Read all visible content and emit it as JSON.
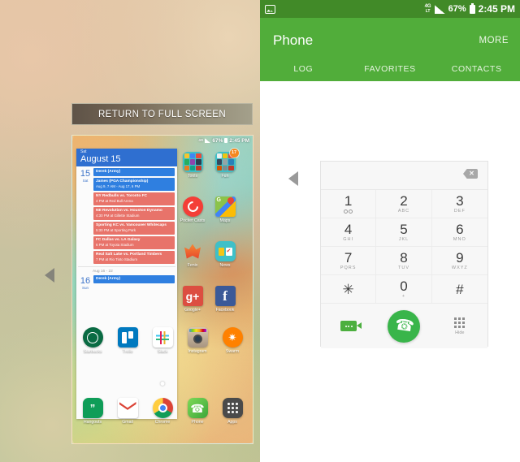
{
  "left": {
    "return_button": "RETURN TO FULL SCREEN",
    "drag_handle_icon": "left-triangle-icon",
    "preview": {
      "status": {
        "network": "4G",
        "network_sub": "LT",
        "battery": "67%",
        "time": "2:45 PM"
      },
      "calendar": {
        "header_dow": "Sat",
        "header_date": "August 15",
        "day_number": "15",
        "day_name": "Sat",
        "events": [
          {
            "title": "Derek (Army)",
            "sub": "",
            "color": "blue"
          },
          {
            "title": "James (PGA Championship)",
            "sub": "Aug 9, 7 AM - Aug 17, 6 PM",
            "color": "blue"
          },
          {
            "title": "NY Redbulls vs. Toronto FC",
            "sub": "4 PM at Red Bull Arena",
            "color": "red"
          },
          {
            "title": "NE Revolution vs. Houston Dynamo",
            "sub": "4:30 PM at Gillette Stadium",
            "color": "red"
          },
          {
            "title": "Sporting KC vs. Vancouver Whitecaps",
            "sub": "5:30 PM at Sporting Park",
            "color": "red"
          },
          {
            "title": "FC Dallas vs. LA Galaxy",
            "sub": "6 PM at Toyota Stadium",
            "color": "red"
          },
          {
            "title": "Real Salt Lake vs. Portland Timbers",
            "sub": "7 PM at Rio Tinto Stadium",
            "color": "red"
          }
        ],
        "week_separator": "Aug 16 - 22",
        "next_day_number": "16",
        "next_day_name": "Sun",
        "next_event": "Derek (Army)"
      },
      "apps_right": [
        {
          "label": "Tools",
          "badge": ""
        },
        {
          "label": "Fun",
          "badge": "17"
        },
        {
          "label": "Pocket Casts",
          "badge": ""
        },
        {
          "label": "Maps",
          "badge": ""
        },
        {
          "label": "Fenix",
          "badge": ""
        },
        {
          "label": "News",
          "badge": ""
        },
        {
          "label": "Google+",
          "badge": ""
        },
        {
          "label": "Facebook",
          "badge": ""
        }
      ],
      "apps_row": [
        {
          "label": "Starbucks"
        },
        {
          "label": "Trello"
        },
        {
          "label": "Slack"
        },
        {
          "label": "Instagram"
        },
        {
          "label": "Swarm"
        }
      ],
      "dock": [
        {
          "label": "Hangouts"
        },
        {
          "label": "Gmail"
        },
        {
          "label": "Chrome"
        },
        {
          "label": "Phone"
        },
        {
          "label": "Apps"
        }
      ]
    }
  },
  "right": {
    "status": {
      "screenshot_icon": "image-icon",
      "network": "4G",
      "network_sub": "LT",
      "battery": "67%",
      "time": "2:45 PM"
    },
    "appbar": {
      "title": "Phone",
      "more": "MORE",
      "tabs": [
        {
          "label": "LOG"
        },
        {
          "label": "FAVORITES"
        },
        {
          "label": "CONTACTS"
        }
      ]
    },
    "drag_handle_icon": "left-triangle-icon",
    "dialpad": {
      "entry_value": "",
      "backspace_icon": "backspace-icon",
      "keys": [
        {
          "num": "1",
          "sub": "",
          "voicemail": true
        },
        {
          "num": "2",
          "sub": "ABC",
          "voicemail": false
        },
        {
          "num": "3",
          "sub": "DEF",
          "voicemail": false
        },
        {
          "num": "4",
          "sub": "GHI",
          "voicemail": false
        },
        {
          "num": "5",
          "sub": "JKL",
          "voicemail": false
        },
        {
          "num": "6",
          "sub": "MNO",
          "voicemail": false
        },
        {
          "num": "7",
          "sub": "PQRS",
          "voicemail": false
        },
        {
          "num": "8",
          "sub": "TUV",
          "voicemail": false
        },
        {
          "num": "9",
          "sub": "WXYZ",
          "voicemail": false
        },
        {
          "num": "✳",
          "sub": "",
          "voicemail": false
        },
        {
          "num": "0",
          "sub": "+",
          "voicemail": false
        },
        {
          "num": "#",
          "sub": "",
          "voicemail": false
        }
      ],
      "actions": {
        "video_call_icon": "video-camera-icon",
        "call_icon": "phone-handset-icon",
        "hide_icon": "keypad-dots-icon",
        "hide_label": "Hide"
      }
    }
  },
  "colors": {
    "status_bar_green": "#418a28",
    "app_bar_green": "#51ad3a",
    "call_button_green": "#39b54a",
    "event_blue": "#2f7fe0",
    "event_red": "#e8736a",
    "badge_orange": "#f5871f"
  }
}
